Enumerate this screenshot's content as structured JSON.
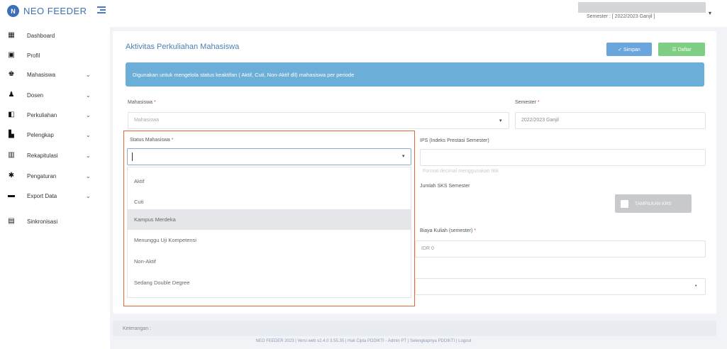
{
  "app": {
    "name": "NEO FEEDER",
    "logo_letter": "N"
  },
  "header": {
    "user_name": "",
    "semester_info": "Semester : [ 2022/2023 Ganjil ]"
  },
  "sidebar": {
    "items": [
      {
        "label": "Dashboard",
        "icon": "dashboard-icon",
        "glyph": "▦",
        "expandable": false
      },
      {
        "label": "Profil",
        "icon": "profile-icon",
        "glyph": "▣",
        "expandable": false
      },
      {
        "label": "Mahasiswa",
        "icon": "student-icon",
        "glyph": "♚",
        "expandable": true
      },
      {
        "label": "Dosen",
        "icon": "lecturer-icon",
        "glyph": "♟",
        "expandable": true
      },
      {
        "label": "Perkuliahan",
        "icon": "lecture-icon",
        "glyph": "◧",
        "expandable": true
      },
      {
        "label": "Pelengkap",
        "icon": "briefcase-icon",
        "glyph": "▙",
        "expandable": true
      },
      {
        "label": "Rekapitulasi",
        "icon": "recap-icon",
        "glyph": "▥",
        "expandable": true
      },
      {
        "label": "Pengaturan",
        "icon": "gear-icon",
        "glyph": "✱",
        "expandable": true
      },
      {
        "label": "Export Data",
        "icon": "folder-icon",
        "glyph": "▬",
        "expandable": true
      },
      {
        "label": "Sinkronisasi",
        "icon": "sync-icon",
        "glyph": "▤",
        "expandable": false
      }
    ],
    "chevron": "⌄"
  },
  "main": {
    "title": "Aktivitas Perkuliahan Mahasiswa",
    "simpan_label": "✓ Simpan",
    "daftar_label": "☰ Daftar",
    "info_text": "Digunakan untuk mengelola status keaktifan ( Aktif, Cuti, Non-Aktif dll) mahasiswa per periode",
    "fields": {
      "mahasiswa_label": "Mahasiswa",
      "mahasiswa_placeholder": "Mahasiswa",
      "semester_label": "Semester",
      "semester_value": "2022/2023 Ganjil",
      "status_label": "Status Mahasiswa",
      "ips_label": "IPS (Indeks Prestasi Semester)",
      "ips_hint": "Format decimal menggunakan titik",
      "sks_label": "Jumlah SKS Semester",
      "biaya_label": "Biaya Kuliah (semester)",
      "biaya_value": "IDR 0",
      "required_mark": "*"
    },
    "krs_button": "TAMPILKAN KRS",
    "bottom_strip_label": "Keterangan :",
    "status_options": [
      "Aktif",
      "Cuti",
      "Kampus Merdeka",
      "Menunggu Uji Kompetensi",
      "Non-Aktif",
      "Sedang Double Degree"
    ],
    "status_highlighted_index": 2
  },
  "footer": {
    "text": "NEO FEEDER 2023 | Versi web v2.4.0 3.55.35 | Hak Cipta PDDIKTI - Admin PT | Selengkapnya PDDIKTI | Logout"
  },
  "colors": {
    "brand": "#3d6fb5",
    "info_bar": "#6bafd8",
    "simpan": "#6aa5dd",
    "daftar": "#7ecf83",
    "highlight_border": "#e06a3a"
  }
}
